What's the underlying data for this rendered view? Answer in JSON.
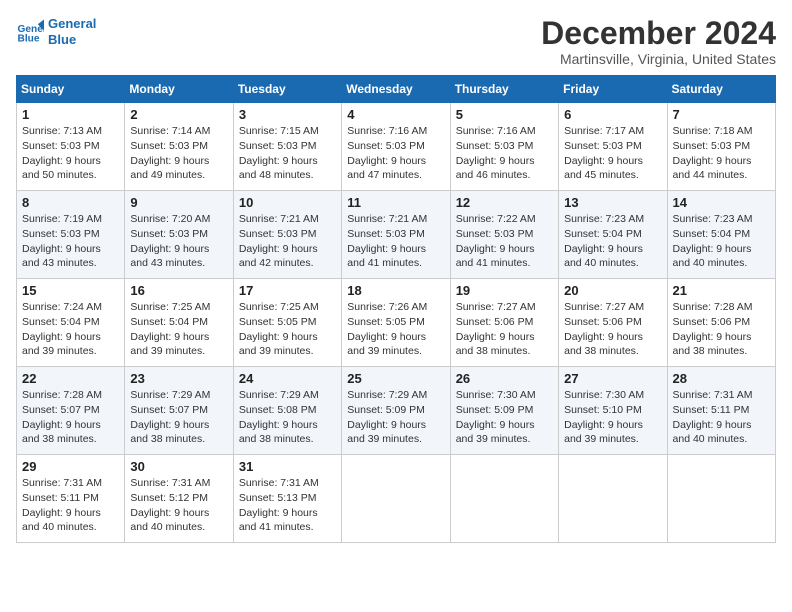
{
  "logo": {
    "line1": "General",
    "line2": "Blue"
  },
  "title": "December 2024",
  "location": "Martinsville, Virginia, United States",
  "weekdays": [
    "Sunday",
    "Monday",
    "Tuesday",
    "Wednesday",
    "Thursday",
    "Friday",
    "Saturday"
  ],
  "weeks": [
    [
      {
        "day": "1",
        "info": "Sunrise: 7:13 AM\nSunset: 5:03 PM\nDaylight: 9 hours\nand 50 minutes."
      },
      {
        "day": "2",
        "info": "Sunrise: 7:14 AM\nSunset: 5:03 PM\nDaylight: 9 hours\nand 49 minutes."
      },
      {
        "day": "3",
        "info": "Sunrise: 7:15 AM\nSunset: 5:03 PM\nDaylight: 9 hours\nand 48 minutes."
      },
      {
        "day": "4",
        "info": "Sunrise: 7:16 AM\nSunset: 5:03 PM\nDaylight: 9 hours\nand 47 minutes."
      },
      {
        "day": "5",
        "info": "Sunrise: 7:16 AM\nSunset: 5:03 PM\nDaylight: 9 hours\nand 46 minutes."
      },
      {
        "day": "6",
        "info": "Sunrise: 7:17 AM\nSunset: 5:03 PM\nDaylight: 9 hours\nand 45 minutes."
      },
      {
        "day": "7",
        "info": "Sunrise: 7:18 AM\nSunset: 5:03 PM\nDaylight: 9 hours\nand 44 minutes."
      }
    ],
    [
      {
        "day": "8",
        "info": "Sunrise: 7:19 AM\nSunset: 5:03 PM\nDaylight: 9 hours\nand 43 minutes."
      },
      {
        "day": "9",
        "info": "Sunrise: 7:20 AM\nSunset: 5:03 PM\nDaylight: 9 hours\nand 43 minutes."
      },
      {
        "day": "10",
        "info": "Sunrise: 7:21 AM\nSunset: 5:03 PM\nDaylight: 9 hours\nand 42 minutes."
      },
      {
        "day": "11",
        "info": "Sunrise: 7:21 AM\nSunset: 5:03 PM\nDaylight: 9 hours\nand 41 minutes."
      },
      {
        "day": "12",
        "info": "Sunrise: 7:22 AM\nSunset: 5:03 PM\nDaylight: 9 hours\nand 41 minutes."
      },
      {
        "day": "13",
        "info": "Sunrise: 7:23 AM\nSunset: 5:04 PM\nDaylight: 9 hours\nand 40 minutes."
      },
      {
        "day": "14",
        "info": "Sunrise: 7:23 AM\nSunset: 5:04 PM\nDaylight: 9 hours\nand 40 minutes."
      }
    ],
    [
      {
        "day": "15",
        "info": "Sunrise: 7:24 AM\nSunset: 5:04 PM\nDaylight: 9 hours\nand 39 minutes."
      },
      {
        "day": "16",
        "info": "Sunrise: 7:25 AM\nSunset: 5:04 PM\nDaylight: 9 hours\nand 39 minutes."
      },
      {
        "day": "17",
        "info": "Sunrise: 7:25 AM\nSunset: 5:05 PM\nDaylight: 9 hours\nand 39 minutes."
      },
      {
        "day": "18",
        "info": "Sunrise: 7:26 AM\nSunset: 5:05 PM\nDaylight: 9 hours\nand 39 minutes."
      },
      {
        "day": "19",
        "info": "Sunrise: 7:27 AM\nSunset: 5:06 PM\nDaylight: 9 hours\nand 38 minutes."
      },
      {
        "day": "20",
        "info": "Sunrise: 7:27 AM\nSunset: 5:06 PM\nDaylight: 9 hours\nand 38 minutes."
      },
      {
        "day": "21",
        "info": "Sunrise: 7:28 AM\nSunset: 5:06 PM\nDaylight: 9 hours\nand 38 minutes."
      }
    ],
    [
      {
        "day": "22",
        "info": "Sunrise: 7:28 AM\nSunset: 5:07 PM\nDaylight: 9 hours\nand 38 minutes."
      },
      {
        "day": "23",
        "info": "Sunrise: 7:29 AM\nSunset: 5:07 PM\nDaylight: 9 hours\nand 38 minutes."
      },
      {
        "day": "24",
        "info": "Sunrise: 7:29 AM\nSunset: 5:08 PM\nDaylight: 9 hours\nand 38 minutes."
      },
      {
        "day": "25",
        "info": "Sunrise: 7:29 AM\nSunset: 5:09 PM\nDaylight: 9 hours\nand 39 minutes."
      },
      {
        "day": "26",
        "info": "Sunrise: 7:30 AM\nSunset: 5:09 PM\nDaylight: 9 hours\nand 39 minutes."
      },
      {
        "day": "27",
        "info": "Sunrise: 7:30 AM\nSunset: 5:10 PM\nDaylight: 9 hours\nand 39 minutes."
      },
      {
        "day": "28",
        "info": "Sunrise: 7:31 AM\nSunset: 5:11 PM\nDaylight: 9 hours\nand 40 minutes."
      }
    ],
    [
      {
        "day": "29",
        "info": "Sunrise: 7:31 AM\nSunset: 5:11 PM\nDaylight: 9 hours\nand 40 minutes."
      },
      {
        "day": "30",
        "info": "Sunrise: 7:31 AM\nSunset: 5:12 PM\nDaylight: 9 hours\nand 40 minutes."
      },
      {
        "day": "31",
        "info": "Sunrise: 7:31 AM\nSunset: 5:13 PM\nDaylight: 9 hours\nand 41 minutes."
      },
      {
        "day": "",
        "info": ""
      },
      {
        "day": "",
        "info": ""
      },
      {
        "day": "",
        "info": ""
      },
      {
        "day": "",
        "info": ""
      }
    ]
  ]
}
